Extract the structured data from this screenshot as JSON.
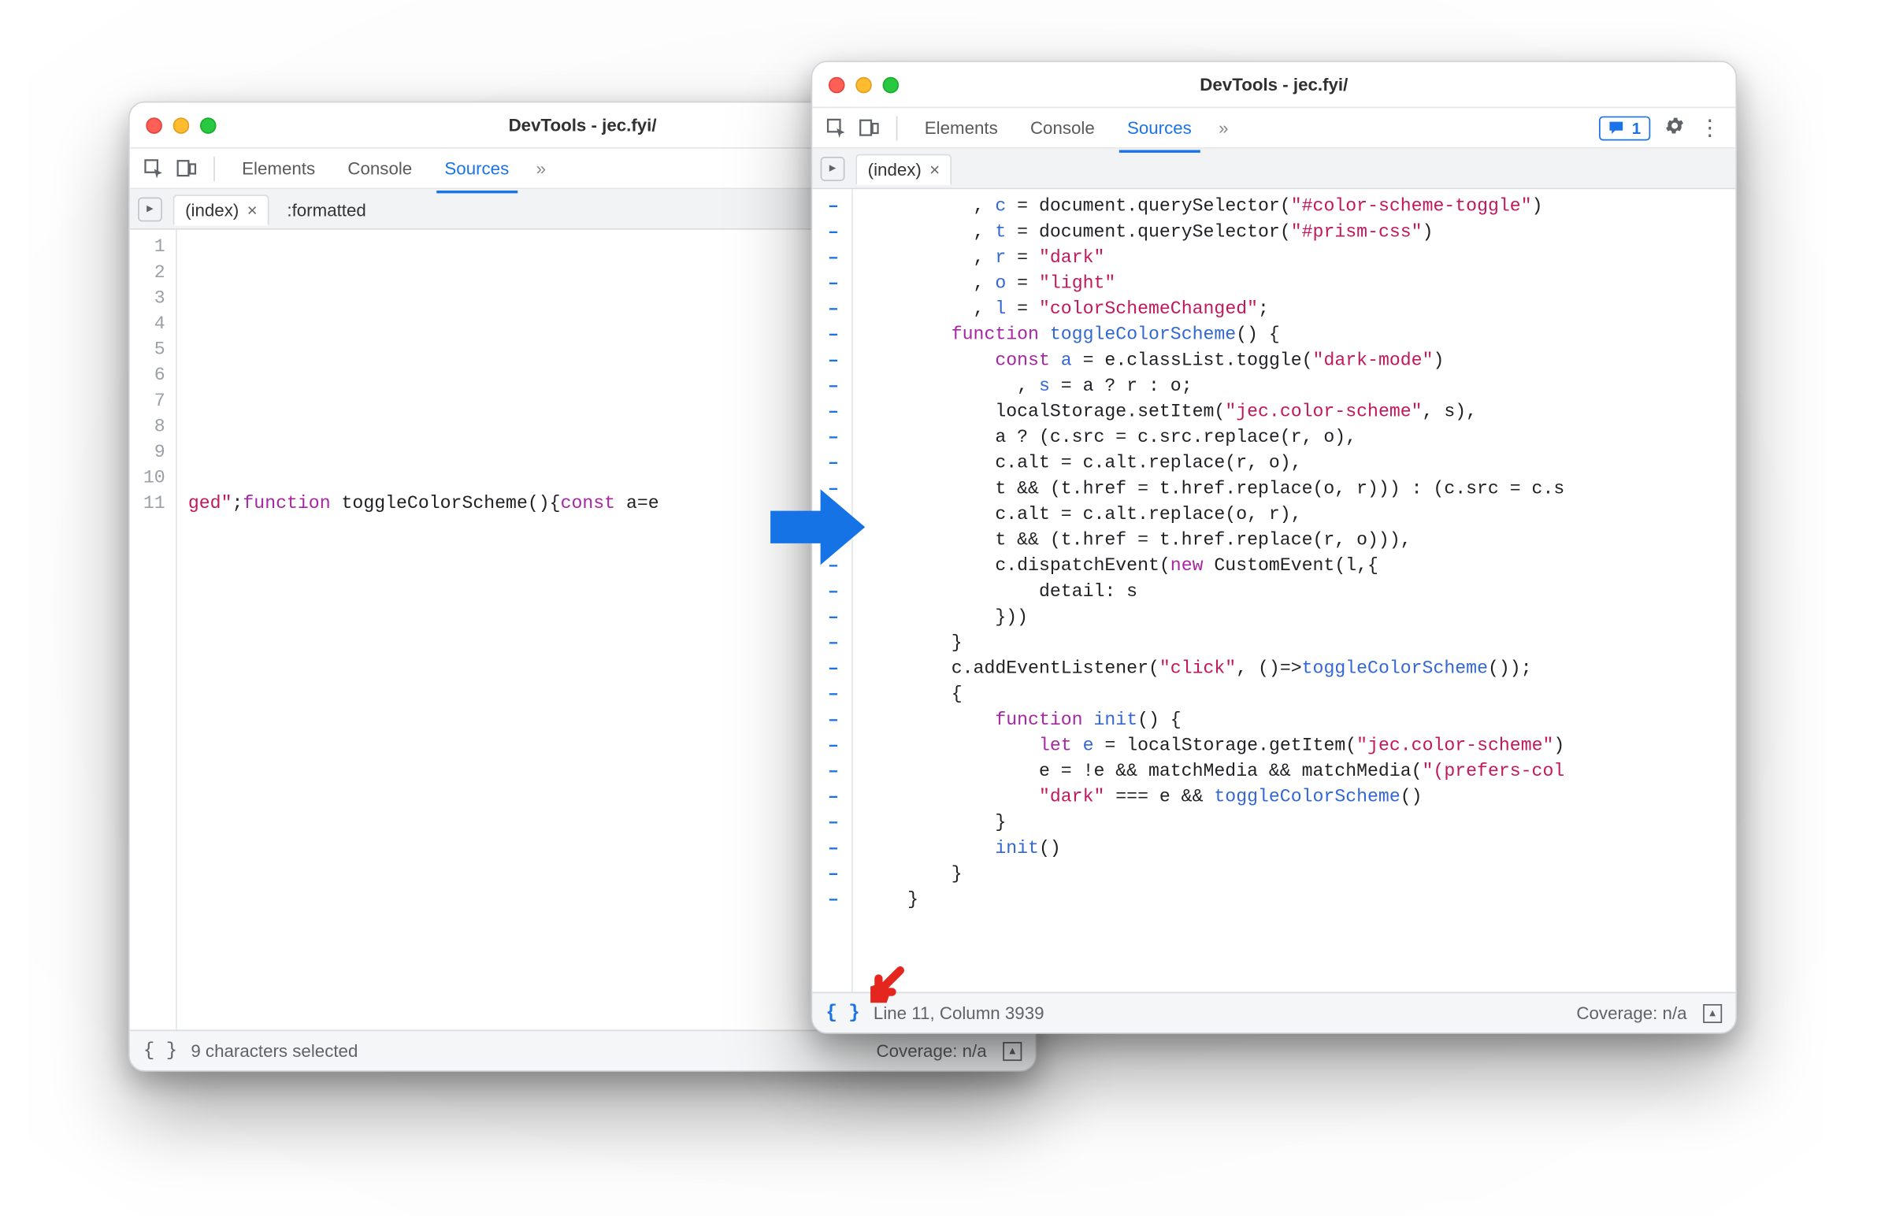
{
  "left_window": {
    "title": "DevTools - jec.fyi/",
    "tabs": {
      "elements": "Elements",
      "console": "Console",
      "sources": "Sources",
      "more": "»"
    },
    "file_tabs": {
      "index": "(index)",
      "formatted": ":formatted"
    },
    "gutter_lines": [
      "1",
      "2",
      "3",
      "4",
      "5",
      "6",
      "7",
      "8",
      "9",
      "10",
      "11"
    ],
    "code_line11": {
      "head": "ged\"",
      "semi": ";",
      "kw1": "function",
      "fnname": " toggleColorScheme(){",
      "kw2": "const",
      "tail": " a=e"
    },
    "status": {
      "braces": "{ }",
      "msg": "9 characters selected",
      "coverage": "Coverage: n/a"
    }
  },
  "right_window": {
    "title": "DevTools - jec.fyi/",
    "tabs": {
      "elements": "Elements",
      "console": "Console",
      "sources": "Sources",
      "more": "»"
    },
    "issues_count": "1",
    "file_tabs": {
      "index": "(index)"
    },
    "status": {
      "braces": "{ }",
      "msg": "Line 11, Column 3939",
      "coverage": "Coverage: n/a"
    },
    "code_tokens": {
      "l1": [
        ", ",
        "c",
        " = ",
        "document.querySelector(",
        "\"#color-scheme-toggle\"",
        ")"
      ],
      "l2": [
        ", ",
        "t",
        " = ",
        "document.querySelector(",
        "\"#prism-css\"",
        ")"
      ],
      "l3": [
        ", ",
        "r",
        " = ",
        "\"dark\"",
        ""
      ],
      "l4": [
        ", ",
        "o",
        " = ",
        "\"light\"",
        ""
      ],
      "l5": [
        ", ",
        "l",
        " = ",
        "\"colorSchemeChanged\"",
        ";"
      ],
      "l6": [
        "function",
        " ",
        "toggleColorScheme",
        "() {"
      ],
      "l7": [
        "const",
        " ",
        "a",
        " = e.classList.toggle(",
        "\"dark-mode\"",
        ")"
      ],
      "l8": [
        "  , ",
        "s",
        " = a ? r : o;"
      ],
      "l9": [
        "localStorage.setItem(",
        "\"jec.color-scheme\"",
        ", s),"
      ],
      "l10": [
        "a ? (c.src = c.src.replace(r, o),"
      ],
      "l11": [
        "c.alt = c.alt.replace(r, o),"
      ],
      "l12": [
        "t && (t.href = t.href.replace(o, r))) : (c.src = c.s"
      ],
      "l13": [
        "c.alt = c.alt.replace(o, r),"
      ],
      "l14": [
        "t && (t.href = t.href.replace(r, o))),"
      ],
      "l15": [
        "c.dispatchEvent(",
        "new",
        " CustomEvent(l,{"
      ],
      "l16": [
        "    detail: s"
      ],
      "l17": [
        "}))"
      ],
      "l18": [
        "}"
      ],
      "l19": [
        "c.addEventListener(",
        "\"click\"",
        ", ()=>",
        "toggleColorScheme",
        "());"
      ],
      "l20": [
        "{"
      ],
      "l21": [
        "function",
        " ",
        "init",
        "() {"
      ],
      "l22": [
        "let",
        " ",
        "e",
        " = localStorage.getItem(",
        "\"jec.color-scheme\"",
        ")"
      ],
      "l23": [
        "e = !e && matchMedia && matchMedia(",
        "\"(prefers-col",
        ""
      ],
      "l24": [
        "\"dark\"",
        " === e && ",
        "toggleColorScheme",
        "()"
      ],
      "l25": [
        "}"
      ],
      "l26": [
        "init",
        "()"
      ],
      "l27": [
        "}"
      ],
      "l28": [
        "}"
      ]
    }
  }
}
